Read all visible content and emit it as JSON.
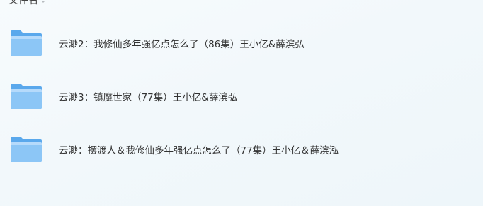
{
  "header": {
    "label": "文件名"
  },
  "files": [
    {
      "name": "云渺2：我修仙多年强亿点怎么了（86集）王小亿&薛滨弘",
      "type": "folder-icon"
    },
    {
      "name": "云渺3：镇魔世家（77集）王小亿&薛滨弘",
      "type": "folder-icon"
    },
    {
      "name": "云渺：摆渡人＆我修仙多年强亿点怎么了（77集）王小亿＆薛滨泓",
      "type": "folder-icon"
    }
  ],
  "colors": {
    "folder_back": "#5aa8ec",
    "folder_front": "#8cc6f6",
    "folder_highlight": "#b5dafb",
    "text": "#333333"
  }
}
